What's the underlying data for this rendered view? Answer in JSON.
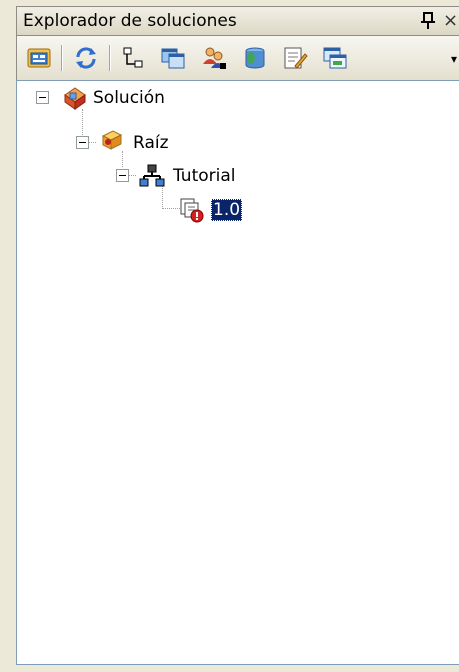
{
  "panel": {
    "title": "Explorador de soluciones",
    "pin_glyph": "ᵖ",
    "close_glyph": "×"
  },
  "toolbar": {
    "buttons": [
      {
        "icon": "properties-icon"
      },
      {
        "icon": "refresh-icon"
      },
      {
        "icon": "hierarchy-view-icon"
      },
      {
        "icon": "copy-window-icon"
      },
      {
        "icon": "users-icon"
      },
      {
        "icon": "database-icon"
      },
      {
        "icon": "edit-document-icon"
      },
      {
        "icon": "windows-icon"
      }
    ],
    "overflow_glyph": "▾"
  },
  "tree": {
    "nodes": [
      {
        "label": "Solución",
        "icon": "solution-icon",
        "expanded": true
      },
      {
        "label": "Raíz",
        "icon": "root-box-icon",
        "expanded": true
      },
      {
        "label": "Tutorial",
        "icon": "hierarchy-icon",
        "expanded": true
      },
      {
        "label": "1.0",
        "icon": "version-error-icon",
        "selected": true
      }
    ]
  }
}
